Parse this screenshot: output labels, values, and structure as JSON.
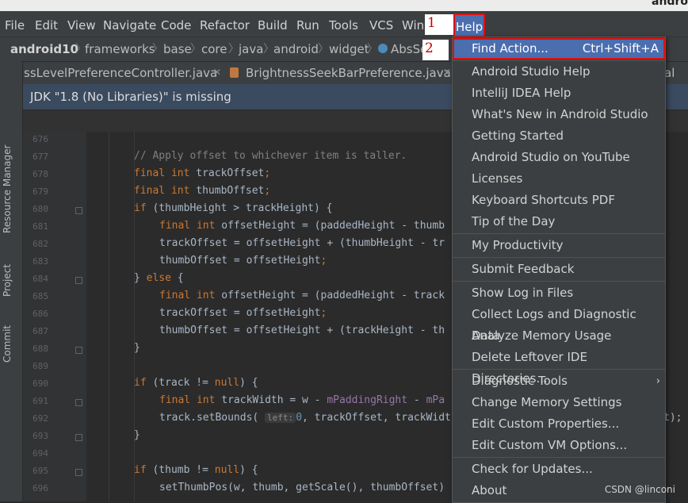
{
  "window": {
    "title_fragment": "andro"
  },
  "menubar": {
    "items": [
      "File",
      "Edit",
      "View",
      "Navigate",
      "Code",
      "Refactor",
      "Build",
      "Run",
      "Tools",
      "VCS",
      "Wind",
      "Help"
    ],
    "annot1": "1"
  },
  "breadcrumb": {
    "items": [
      "android10",
      "frameworks",
      "base",
      "core",
      "java",
      "android",
      "widget",
      "AbsSe"
    ],
    "annot2": "2"
  },
  "tabs": [
    "ssLevelPreferenceController.java",
    "BrightnessSeekBarPreference.java",
    "al"
  ],
  "left_strip": [
    "Resource Manager",
    "Project",
    "Commit"
  ],
  "banner": {
    "text": "JDK \"1.8 (No Libraries)\" is missing"
  },
  "code": {
    "line_numbers": [
      "676",
      "677",
      "678",
      "679",
      "680",
      "681",
      "682",
      "683",
      "684",
      "685",
      "686",
      "687",
      "688",
      "689",
      "690",
      "691",
      "692",
      "693",
      "694",
      "695",
      "696"
    ],
    "hint_left": "left:",
    "lines": {
      "l677": "// Apply offset to whichever item is taller.",
      "l692_tail": "t);"
    }
  },
  "help_menu": {
    "items": [
      {
        "label": "Find Action...",
        "shortcut": "Ctrl+Shift+A"
      },
      {
        "label": "Android Studio Help"
      },
      {
        "label": "IntelliJ IDEA Help"
      },
      {
        "label": "What's New in Android Studio"
      },
      {
        "label": "Getting Started"
      },
      {
        "label": "Android Studio on YouTube"
      },
      {
        "label": "Licenses"
      },
      {
        "label": "Keyboard Shortcuts PDF"
      },
      {
        "label": "Tip of the Day"
      },
      {
        "label": "My Productivity"
      },
      {
        "label": "Submit Feedback"
      },
      {
        "label": "Show Log in Files"
      },
      {
        "label": "Collect Logs and Diagnostic Data"
      },
      {
        "label": "Analyze Memory Usage"
      },
      {
        "label": "Delete Leftover IDE Directories..."
      },
      {
        "label": "Diagnostic Tools"
      },
      {
        "label": "Change Memory Settings"
      },
      {
        "label": "Edit Custom Properties..."
      },
      {
        "label": "Edit Custom VM Options..."
      },
      {
        "label": "Check for Updates..."
      },
      {
        "label": "About"
      }
    ]
  },
  "watermark": "CSDN @linconi",
  "colors": {
    "accent": "#4b6eaf",
    "annotation_red": "#dd1111",
    "keyword": "#cc7832",
    "field": "#9876aa"
  }
}
